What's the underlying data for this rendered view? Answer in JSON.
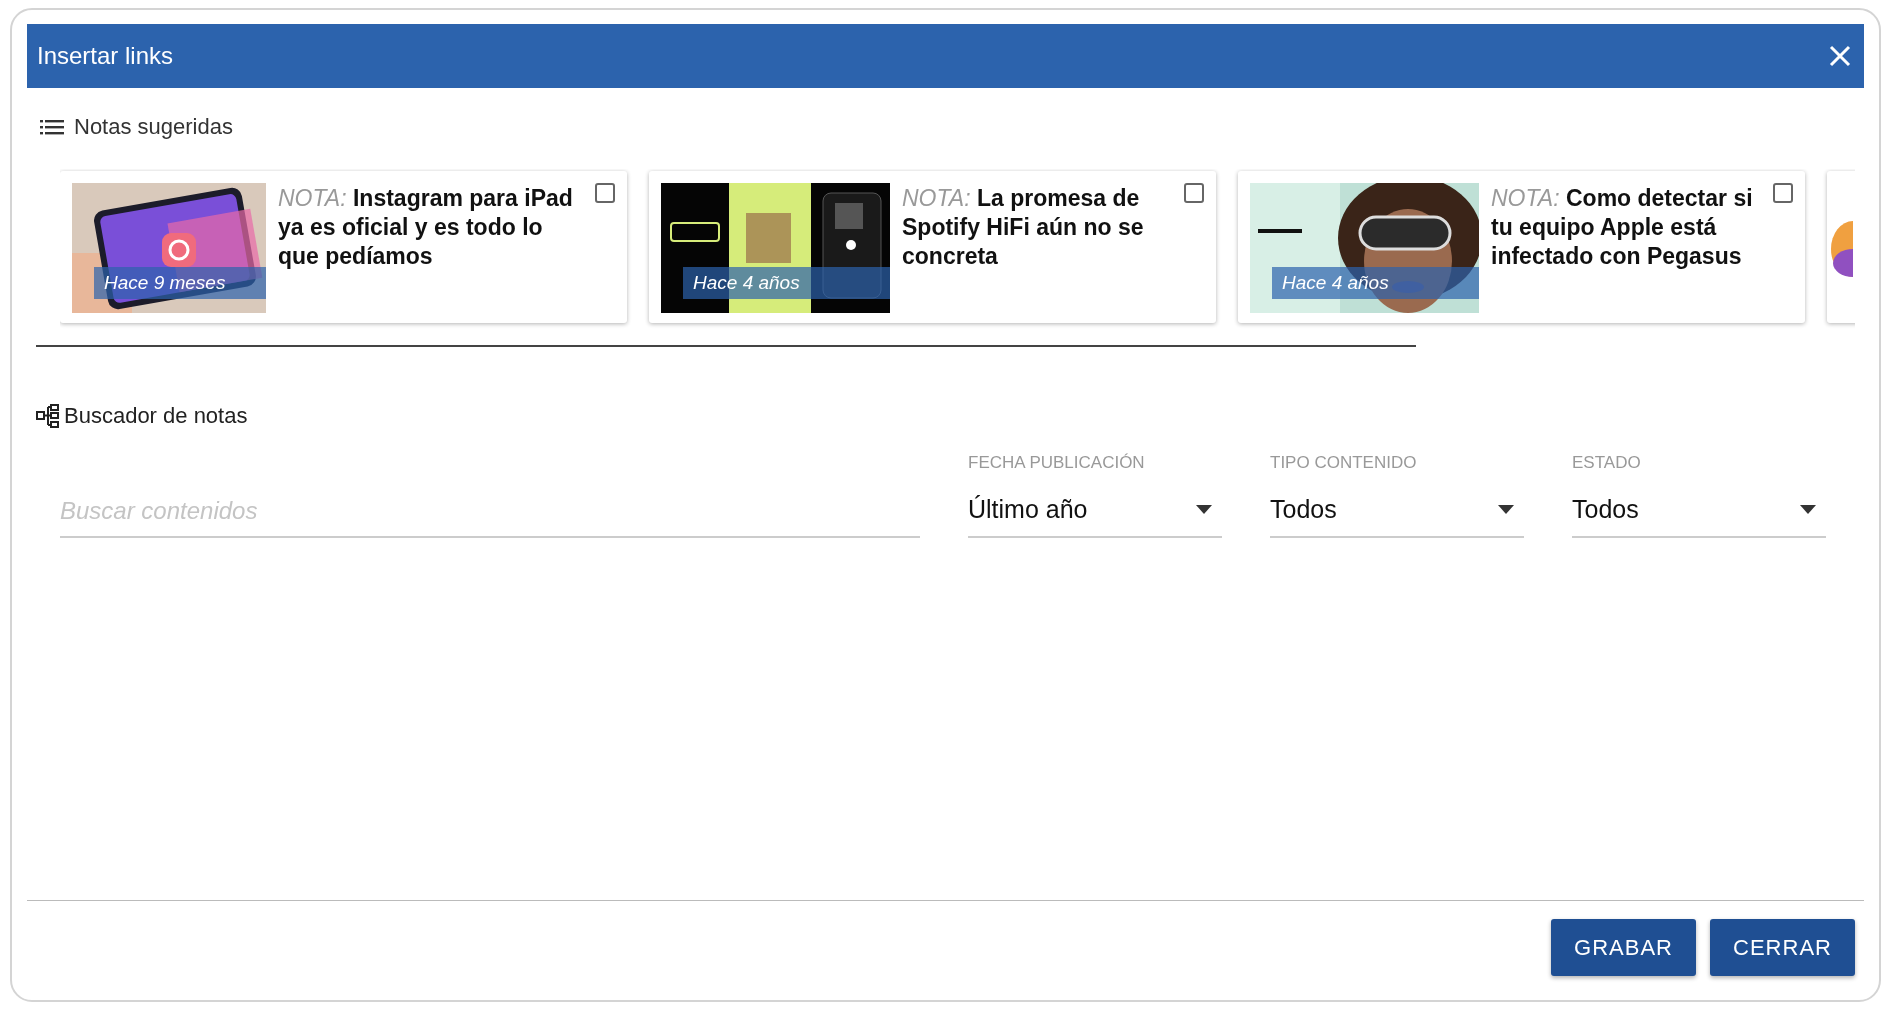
{
  "dialog": {
    "title": "Insertar links"
  },
  "suggested": {
    "heading": "Notas sugeridas",
    "cards": [
      {
        "prefix": "NOTA:",
        "title": "Instagram para iPad ya es oficial y es todo lo que pedíamos",
        "age": "Hace 9 meses",
        "checked": false
      },
      {
        "prefix": "NOTA:",
        "title": "La promesa de Spotify HiFi aún no se concreta",
        "age": "Hace 4 años",
        "checked": false
      },
      {
        "prefix": "NOTA:",
        "title": "Como detectar si tu equipo Apple está infectado con Pegasus",
        "age": "Hace 4 años",
        "checked": false
      }
    ]
  },
  "search": {
    "heading": "Buscador de notas",
    "placeholder": "Buscar contenidos",
    "filters": [
      {
        "label": "FECHA PUBLICACIÓN",
        "value": "Último año"
      },
      {
        "label": "TIPO CONTENIDO",
        "value": "Todos"
      },
      {
        "label": "ESTADO",
        "value": "Todos"
      }
    ]
  },
  "buttons": [
    "GRABAR",
    "CERRAR"
  ]
}
